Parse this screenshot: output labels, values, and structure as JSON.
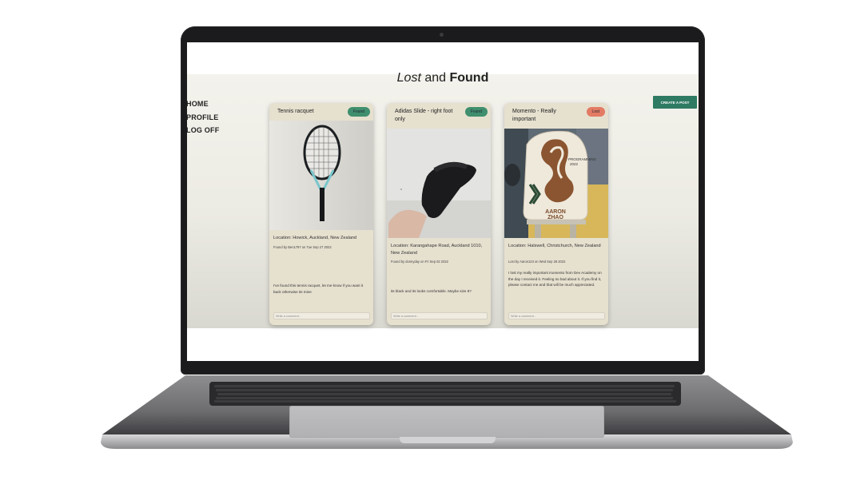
{
  "app": {
    "title_italic": "Lost",
    "title_mid": " and ",
    "title_bold": "Found",
    "nav": [
      "HOME",
      "PROFILE",
      "LOG OFF"
    ],
    "create_button": "CREATE A POST",
    "comment_placeholder": "Write a comment..."
  },
  "posts": [
    {
      "title": "Tennis racquet",
      "status": "Found",
      "location": "Location: Howick, Auckland, New Zealand",
      "found_by": "Found by Ben1797 on Tue Sep 27 2022",
      "description": "I've found this tennis racquet, let me know if you want it back otherwise its mine"
    },
    {
      "title": "Adidas Slide - right foot only",
      "status": "Found",
      "location": "Location: Karangahape Road, Auckland 1010, New Zealand",
      "found_by": "Found by donnyday on Fri Sep 02 2022",
      "description": "its black and its looks comfortable. Maybe size 8?"
    },
    {
      "title": "Momento - Really important",
      "status": "Lost",
      "location": "Location: Halswell, Christchurch, New Zealand",
      "found_by": "Lost by Aaron123 on Wed Sep 28 2022",
      "description": "I lost my really important momento from Dev Academy on the day I received it. Feeling so bad about it. If you find it, please contact me and that will be much appreciated."
    }
  ],
  "momento_photo_text": [
    "PROGRAMMING",
    "2022",
    "AARON",
    "ZHAO"
  ],
  "colors": {
    "found_badge": "#3f8f6e",
    "lost_badge": "#e37b64",
    "create_button": "#2e7a62",
    "card": "#e6e0cf"
  }
}
